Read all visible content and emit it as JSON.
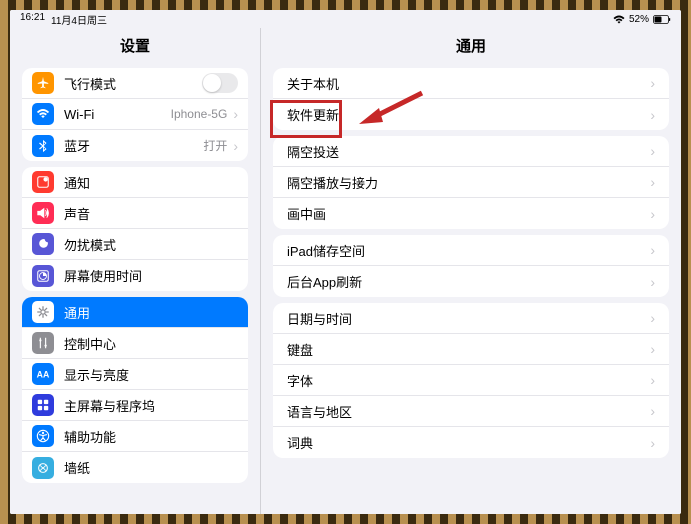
{
  "statusbar": {
    "time": "16:21",
    "date": "11月4日周三",
    "battery": "52%"
  },
  "sidebar": {
    "title": "设置",
    "groups": [
      [
        {
          "label": "飞行模式",
          "icon": "airplane",
          "bg": "#ff9500",
          "toggle": true
        },
        {
          "label": "Wi-Fi",
          "icon": "wifi",
          "bg": "#007aff",
          "detail": "Iphone-5G"
        },
        {
          "label": "蓝牙",
          "icon": "bluetooth",
          "bg": "#007aff",
          "detail": "打开"
        }
      ],
      [
        {
          "label": "通知",
          "icon": "notification",
          "bg": "#ff3b30"
        },
        {
          "label": "声音",
          "icon": "sound",
          "bg": "#ff2d55"
        },
        {
          "label": "勿扰模式",
          "icon": "dnd",
          "bg": "#5856d6"
        },
        {
          "label": "屏幕使用时间",
          "icon": "screentime",
          "bg": "#5856d6"
        }
      ],
      [
        {
          "label": "通用",
          "icon": "general",
          "bg": "#8e8e93",
          "selected": true
        },
        {
          "label": "控制中心",
          "icon": "control",
          "bg": "#8e8e93"
        },
        {
          "label": "显示与亮度",
          "icon": "display",
          "bg": "#007aff"
        },
        {
          "label": "主屏幕与程序坞",
          "icon": "home",
          "bg": "#2f3cdd"
        },
        {
          "label": "辅助功能",
          "icon": "accessibility",
          "bg": "#007aff"
        },
        {
          "label": "墙纸",
          "icon": "wallpaper",
          "bg": "#36aee0"
        }
      ]
    ]
  },
  "main": {
    "title": "通用",
    "groups": [
      [
        "关于本机",
        "软件更新"
      ],
      [
        "隔空投送",
        "隔空播放与接力",
        "画中画"
      ],
      [
        "iPad储存空间",
        "后台App刷新"
      ],
      [
        "日期与时间",
        "键盘",
        "字体",
        "语言与地区",
        "词典"
      ]
    ]
  }
}
